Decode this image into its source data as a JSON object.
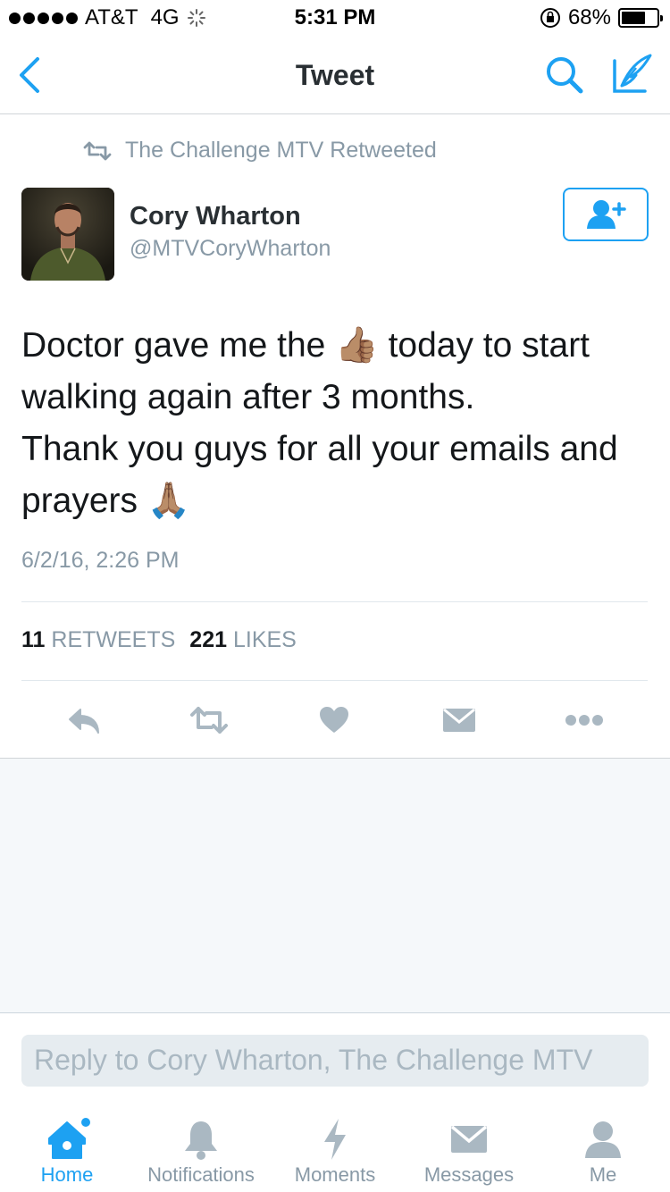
{
  "status_bar": {
    "carrier": "AT&T",
    "network": "4G",
    "time": "5:31 PM",
    "battery_percent": "68%",
    "battery_level": 0.68
  },
  "nav": {
    "title": "Tweet",
    "icons": [
      "back-chevron-icon",
      "search-icon",
      "compose-icon"
    ]
  },
  "tweet": {
    "retweeted_by": "The Challenge MTV Retweeted",
    "author_name": "Cory Wharton",
    "author_handle": "@MTVCoryWharton",
    "text_part1": "Doctor gave me the ",
    "emoji1": "👍🏽",
    "text_part2": " today to start walking again after 3 months.\nThank you guys for all your emails and prayers ",
    "emoji2": "🙏🏽",
    "timestamp": "6/2/16, 2:26 PM",
    "retweets_count": "11",
    "retweets_label": "RETWEETS",
    "likes_count": "221",
    "likes_label": "LIKES"
  },
  "reply": {
    "placeholder": "Reply to Cory Wharton, The Challenge MTV"
  },
  "tabs": [
    {
      "label": "Home",
      "icon": "home-icon",
      "active": true
    },
    {
      "label": "Notifications",
      "icon": "bell-icon"
    },
    {
      "label": "Moments",
      "icon": "lightning-icon"
    },
    {
      "label": "Messages",
      "icon": "envelope-icon"
    },
    {
      "label": "Me",
      "icon": "person-icon"
    }
  ],
  "colors": {
    "accent": "#1da1f2",
    "secondary_text": "#8899a6",
    "icon_gray": "#aab8c2"
  }
}
